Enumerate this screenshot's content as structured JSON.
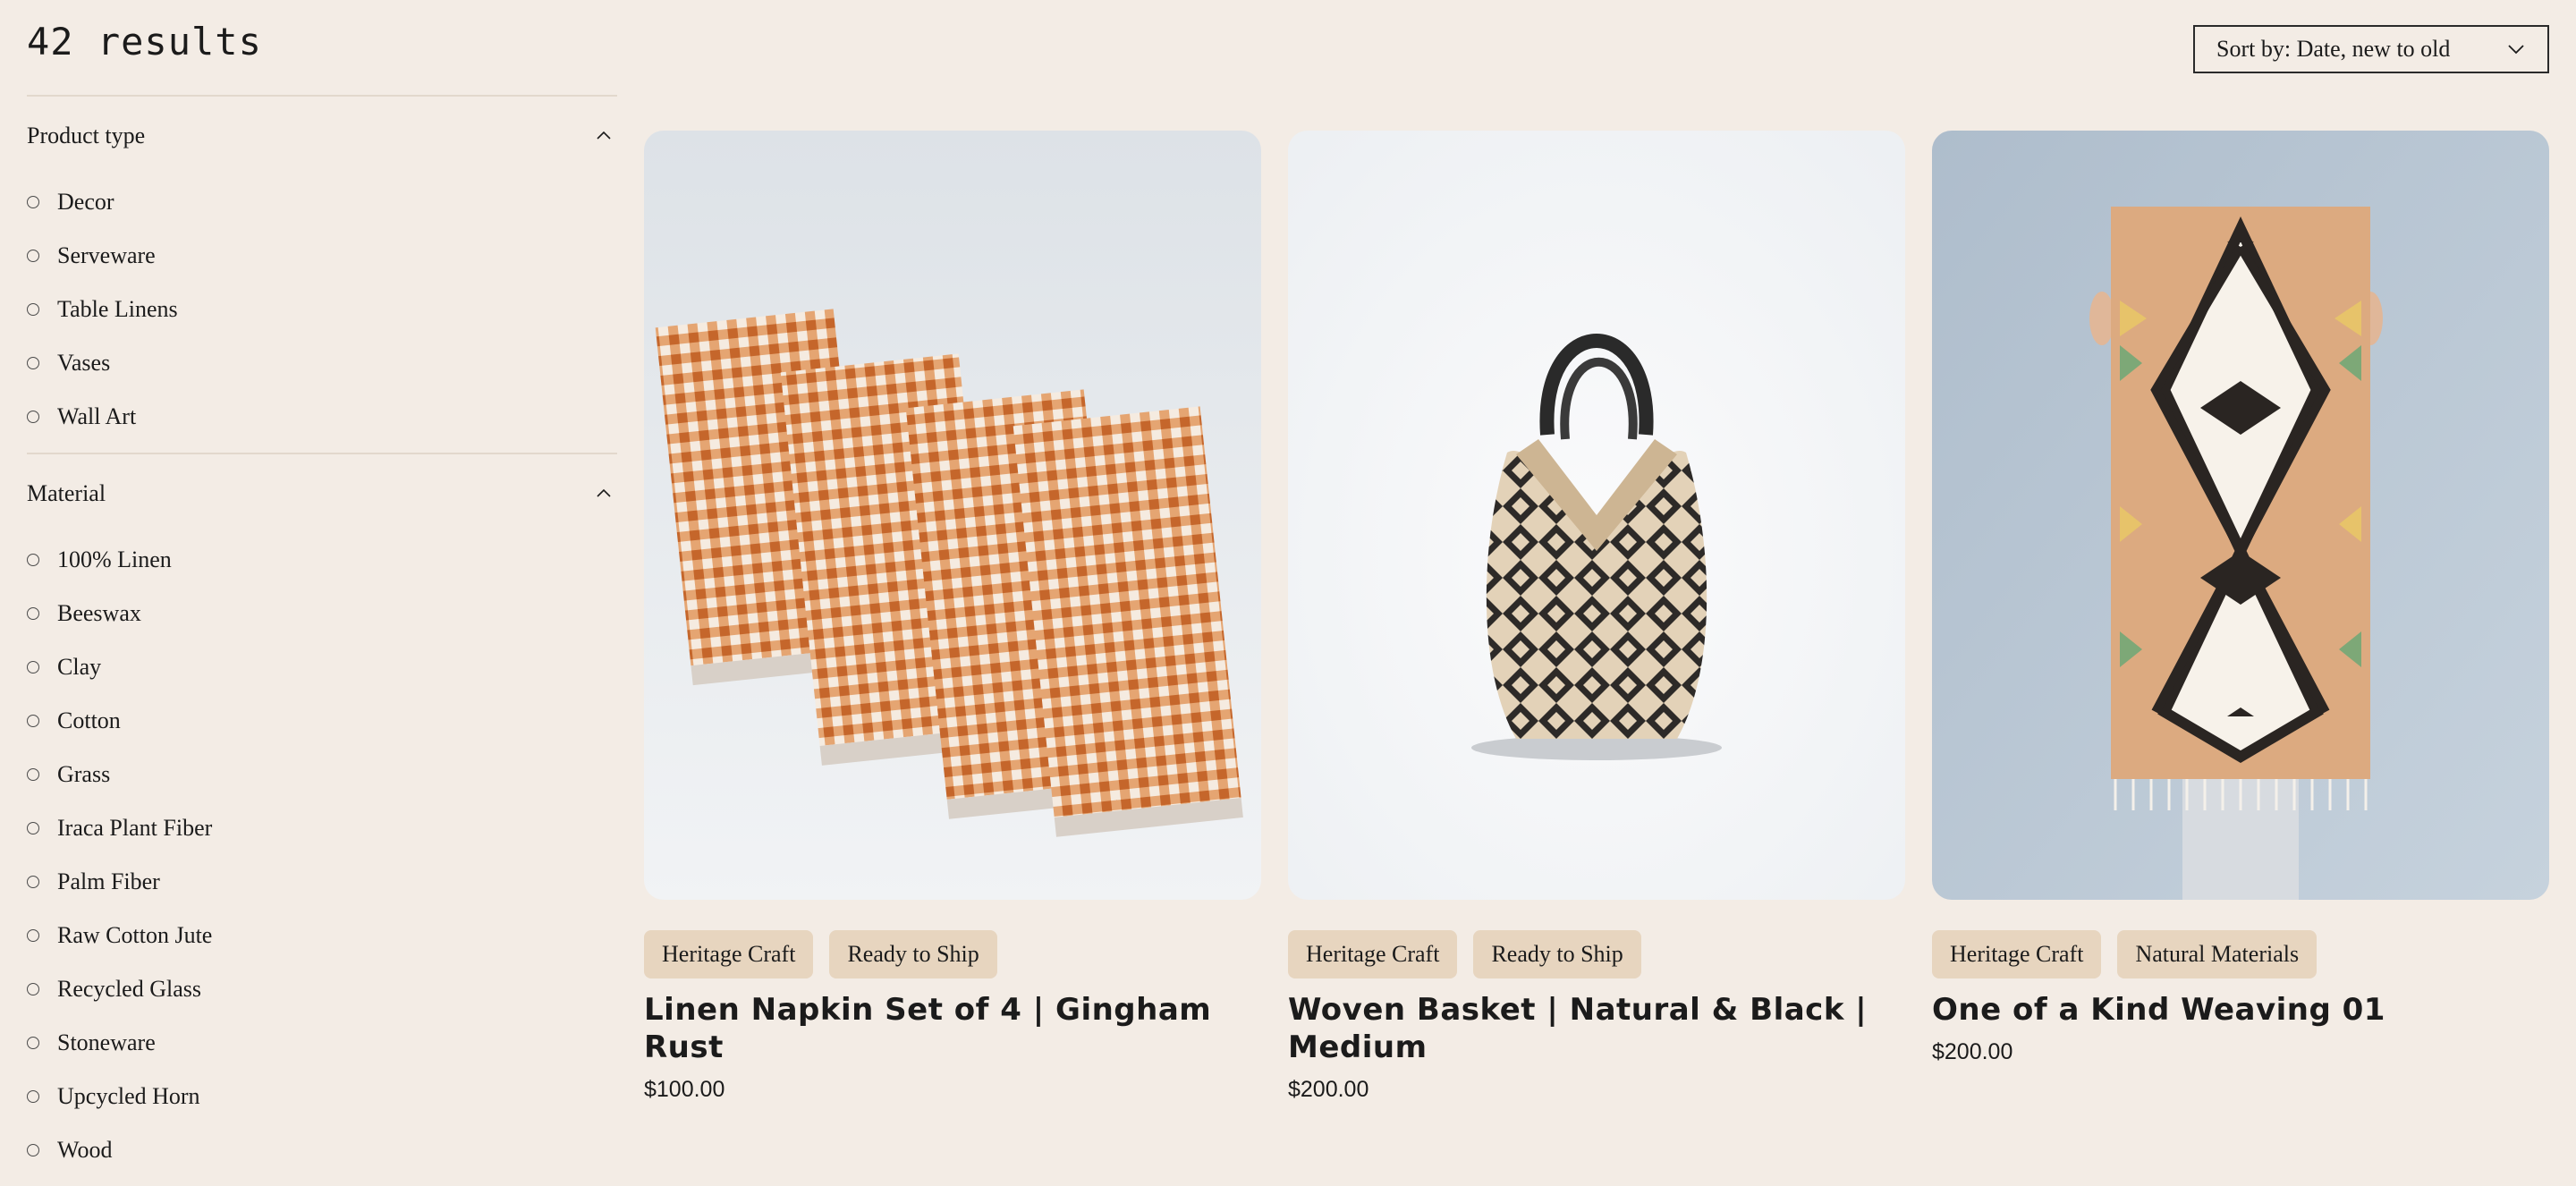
{
  "header": {
    "results": "42 results"
  },
  "sort": {
    "label": "Sort by: Date, new to old"
  },
  "filters": {
    "product_type": {
      "title": "Product type",
      "options": [
        "Decor",
        "Serveware",
        "Table Linens",
        "Vases",
        "Wall Art"
      ]
    },
    "material": {
      "title": "Material",
      "options": [
        "100% Linen",
        "Beeswax",
        "Clay",
        "Cotton",
        "Grass",
        "Iraca Plant Fiber",
        "Palm Fiber",
        "Raw Cotton Jute",
        "Recycled Glass",
        "Stoneware",
        "Upcycled Horn",
        "Wood"
      ]
    }
  },
  "products": [
    {
      "badges": [
        "Heritage Craft",
        "Ready to Ship"
      ],
      "title": "Linen Napkin Set of 4 | Gingham Rust",
      "price": "$100.00"
    },
    {
      "badges": [
        "Heritage Craft",
        "Ready to Ship"
      ],
      "title": "Woven Basket | Natural & Black | Medium",
      "price": "$200.00"
    },
    {
      "badges": [
        "Heritage Craft",
        "Natural Materials"
      ],
      "title": "One of a Kind Weaving 01",
      "price": "$200.00"
    }
  ],
  "colors": {
    "background": "#f3ece5",
    "badge": "#e7d5bf",
    "rust": "#d0773e",
    "basket_dark": "#2d2a28"
  },
  "icons": {
    "sort": "chevron-down-icon",
    "collapse": "chevron-up-icon"
  }
}
